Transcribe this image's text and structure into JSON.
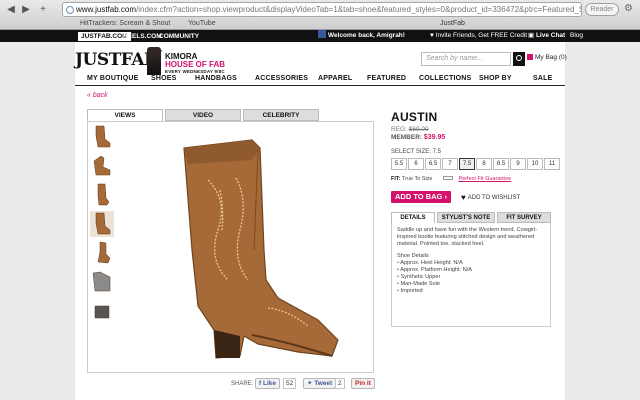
{
  "browser": {
    "url_domain": "www.justfab.com",
    "url_rest": "/index.cfm?action=shop.viewproduct&displayVideoTab=1&tab=shoe&featured_styles=0&product_id=336472&ptrc=Featured_Styles_Tab_Top_Ten_Shoes",
    "reader_label": "Reader",
    "bookmarks": [
      "HitTrackers: Scream & Shout",
      "YouTube"
    ],
    "tab_title": "JustFab"
  },
  "topbar": {
    "tabs": [
      "JUSTFAB.COM",
      "HEELS.COM",
      "COMMUNITY"
    ],
    "welcome": "Welcome back, Amigrah!",
    "invite": "Invite Friends, Get FREE Credit",
    "live_chat": "Live Chat",
    "blog": "Blog"
  },
  "header": {
    "logo": "JUSTFAB",
    "logo_tm": "™",
    "promo_name": "KIMORA",
    "promo_house": "HOUSE OF FAB",
    "promo_when": "EVERY WEDNESDAY 9/8C",
    "search_placeholder": "Search by name...",
    "bag_label": "My Bag (0)"
  },
  "nav": [
    "MY BOUTIQUE",
    "SHOES",
    "HANDBAGS",
    "ACCESSORIES",
    "APPAREL",
    "FEATURED",
    "COLLECTIONS",
    "SHOP BY",
    "SALE"
  ],
  "back_label": "« back",
  "gallery": {
    "tabs": [
      "VIEWS",
      "VIDEO",
      "CELEBRITY"
    ],
    "thumb_count": 7,
    "active_thumb": 3
  },
  "share": {
    "label": "SHARE:",
    "like_label": "Like",
    "like_count": "52",
    "tweet_label": "Tweet",
    "tweet_count": "2",
    "pin_label": "Pin it"
  },
  "product": {
    "title": "AUSTIN",
    "reg_label": "REG:",
    "reg_price": "$69.00",
    "member_label": "MEMBER:",
    "member_price": "$39.95",
    "size_label": "SELECT SIZE: 7.5",
    "sizes": [
      "5.5",
      "6",
      "6.5",
      "7",
      "7.5",
      "8",
      "8.5",
      "9",
      "10",
      "11"
    ],
    "selected_size": "7.5",
    "fit_label": "FIT:",
    "fit_value": "True To Size",
    "fit_guarantee": "Perfect Fit Guarantee",
    "add_to_bag": "ADD TO BAG ›",
    "wishlist": "ADD TO WISHLIST",
    "detail_tabs": [
      "DETAILS",
      "STYLIST'S NOTE",
      "FIT SURVEY"
    ],
    "description": "Saddle up and have fun with the Western trend. Cowgirl-inspired bootie featuring stitched design and weathered material. Pointed toe, stacked heel.",
    "details_heading": "Shoe Details",
    "details": [
      "Approx. Heel Height: N/A",
      "Approx. Platform Height: N/A",
      "Synthetic Upper",
      "Man-Made Sole",
      "Imported"
    ]
  },
  "colors": {
    "brand_pink": "#d4126c",
    "boot_brown": "#a66a38",
    "stitch": "#e9c98f"
  }
}
